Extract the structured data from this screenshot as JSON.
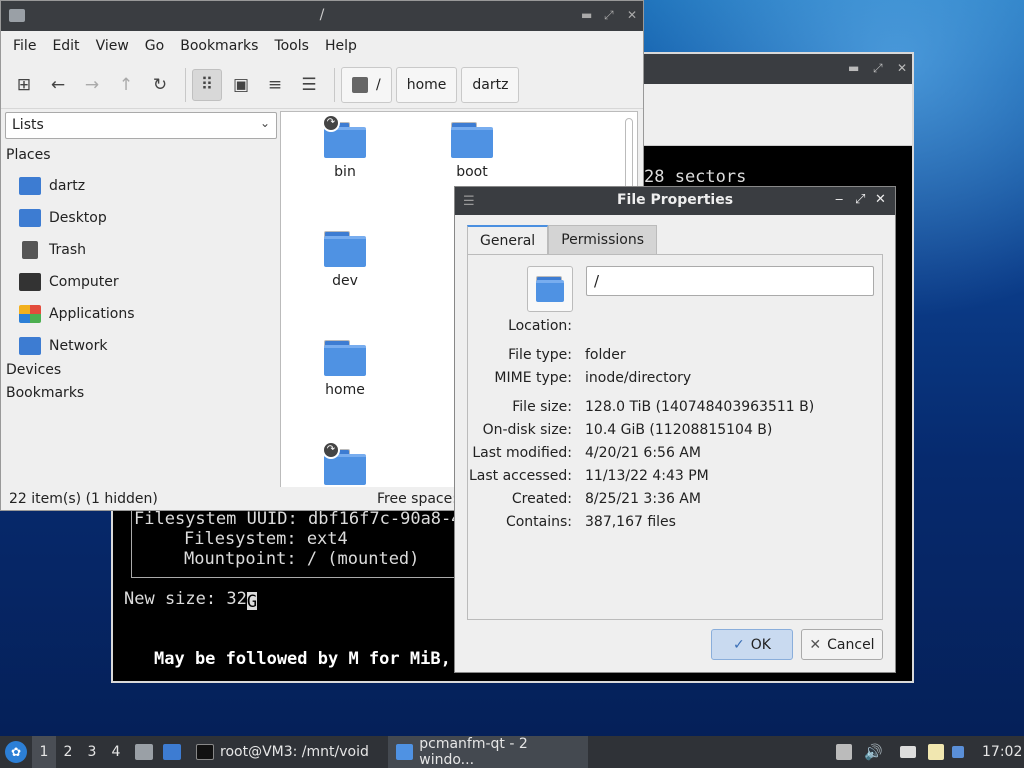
{
  "terminal": {
    "sectors_text": "28 sectors",
    "fs_uuid_line": "Filesystem UUID: dbf16f7c-90a8-4",
    "fs_line": "Filesystem: ext4",
    "mount_line": "Mountpoint: / (mounted)",
    "new_size_label": "New size: 32",
    "cursor_char": "G",
    "hint_line": "May be followed by M for MiB,"
  },
  "file_manager": {
    "title": "/",
    "menu": [
      "File",
      "Edit",
      "View",
      "Go",
      "Bookmarks",
      "Tools",
      "Help"
    ],
    "path": {
      "root": "/",
      "crumbs": [
        "home",
        "dartz"
      ]
    },
    "side_combo": "Lists",
    "places_header": "Places",
    "places": [
      {
        "label": "dartz",
        "icon": "home-folder-icon",
        "color": "#3d7cd2"
      },
      {
        "label": "Desktop",
        "icon": "desktop-icon",
        "color": "#3d7cd2"
      },
      {
        "label": "Trash",
        "icon": "trash-icon",
        "color": "#555555"
      },
      {
        "label": "Computer",
        "icon": "computer-icon",
        "color": "#333333"
      },
      {
        "label": "Applications",
        "icon": "applications-icon",
        "color": "#e34c3c"
      },
      {
        "label": "Network",
        "icon": "network-icon",
        "color": "#3d7cd2"
      }
    ],
    "devices_header": "Devices",
    "bookmarks_header": "Bookmarks",
    "items": [
      {
        "name": "bin",
        "link": true
      },
      {
        "name": "boot",
        "link": false
      },
      {
        "name": "dev",
        "link": false
      },
      {
        "name": "home",
        "link": false
      },
      {
        "name": "",
        "link": true
      }
    ],
    "status_left": "22 item(s) (1 hidden)",
    "status_right": "Free space:"
  },
  "properties": {
    "title": "File Properties",
    "tabs": [
      "General",
      "Permissions"
    ],
    "name_value": "/",
    "location_label": "Location:",
    "rows": [
      {
        "k": "File type:",
        "v": "folder"
      },
      {
        "k": "MIME type:",
        "v": "inode/directory"
      },
      {
        "k": "File size:",
        "v": "128.0 TiB (140748403963511 B)"
      },
      {
        "k": "On-disk size:",
        "v": "10.4 GiB (11208815104 B)"
      },
      {
        "k": "Last modified:",
        "v": "4/20/21 6:56 AM"
      },
      {
        "k": "Last accessed:",
        "v": "11/13/22 4:43 PM"
      },
      {
        "k": "Created:",
        "v": "8/25/21 3:36 AM"
      },
      {
        "k": "Contains:",
        "v": "387,167 files"
      }
    ],
    "ok_label": "OK",
    "cancel_label": "Cancel"
  },
  "taskbar": {
    "desktops": [
      "1",
      "2",
      "3",
      "4"
    ],
    "tasks": [
      {
        "label": "root@VM3: /mnt/void",
        "icon": "terminal-icon"
      },
      {
        "label": "pcmanfm-qt - 2 windo...",
        "icon": "folder-icon"
      }
    ],
    "clock": "17:02"
  }
}
